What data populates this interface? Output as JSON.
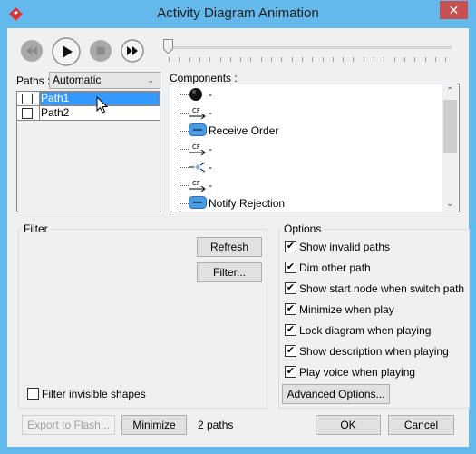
{
  "window": {
    "title": "Activity Diagram Animation",
    "close_label": "✕"
  },
  "paths_label": "Paths :",
  "paths_mode": "Automatic",
  "paths": [
    {
      "name": "Path1",
      "checked": false,
      "selected": true
    },
    {
      "name": "Path2",
      "checked": false,
      "selected": false
    }
  ],
  "components_label": "Components :",
  "components": [
    {
      "icon": "initial-node-icon",
      "label": "-"
    },
    {
      "icon": "control-flow-icon",
      "label": "-"
    },
    {
      "icon": "action-icon",
      "label": "Receive Order"
    },
    {
      "icon": "control-flow-icon",
      "label": "-"
    },
    {
      "icon": "decision-node-icon",
      "label": "-"
    },
    {
      "icon": "control-flow-icon",
      "label": "-"
    },
    {
      "icon": "action-icon",
      "label": "Notify Rejection"
    }
  ],
  "cf_glyph": "CF",
  "slider": {
    "position": 0
  },
  "filter": {
    "title": "Filter",
    "refresh_label": "Refresh",
    "filter_label": "Filter...",
    "invisible_label": "Filter invisible shapes",
    "invisible_checked": false
  },
  "options": {
    "title": "Options",
    "items": [
      {
        "label": "Show invalid paths",
        "checked": true
      },
      {
        "label": "Dim other path",
        "checked": true
      },
      {
        "label": "Show start node when switch path",
        "checked": true
      },
      {
        "label": "Minimize when play",
        "checked": true
      },
      {
        "label": "Lock diagram when playing",
        "checked": true
      },
      {
        "label": "Show description when playing",
        "checked": true
      },
      {
        "label": "Play voice when playing",
        "checked": true
      }
    ],
    "advanced_label": "Advanced Options..."
  },
  "footer": {
    "export_label": "Export to Flash...",
    "minimize_label": "Minimize",
    "status": "2 paths",
    "ok_label": "OK",
    "cancel_label": "Cancel"
  },
  "check_glyph": "✔"
}
